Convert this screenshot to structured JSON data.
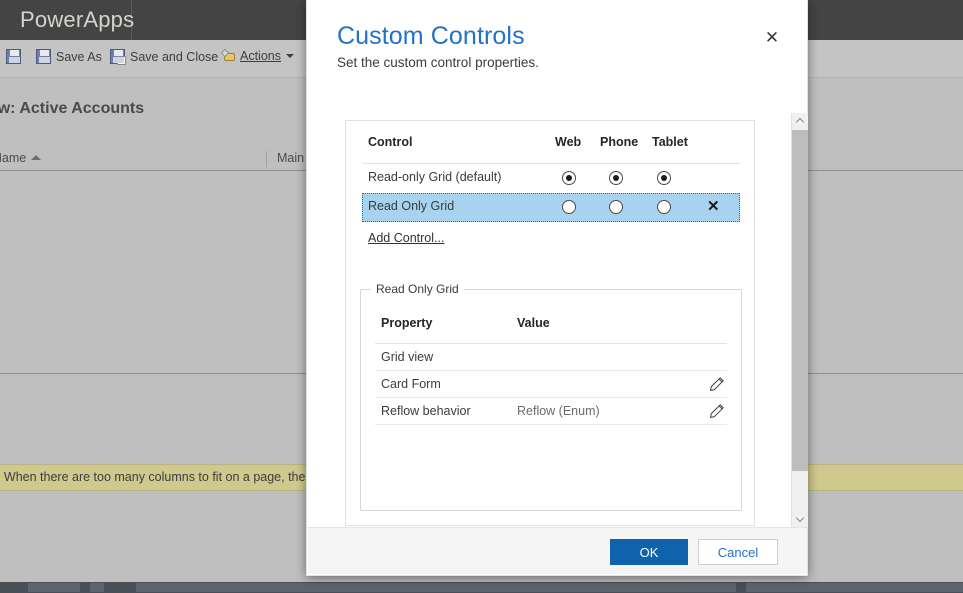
{
  "background": {
    "brand": "PowerApps",
    "toolbar": {
      "save_label": "",
      "save_as_label": "Save As",
      "save_and_close_label": "Save and Close",
      "actions_label": "Actions",
      "actions_caret": "▾"
    },
    "view_title": "View: Active Accounts",
    "grid_columns": [
      {
        "label": "unt Name",
        "sorted": "ascending"
      },
      {
        "label": "Main"
      }
    ],
    "notice": "e: When there are too many columns to fit on a page, the view"
  },
  "dialog": {
    "title": "Custom Controls",
    "subtitle": "Set the custom control properties.",
    "close_label": "✕",
    "controls_table": {
      "headers": [
        "Control",
        "Web",
        "Phone",
        "Tablet"
      ],
      "rows": [
        {
          "name": "Read-only Grid (default)",
          "web": true,
          "phone": true,
          "tablet": true,
          "selected": false,
          "removable": false,
          "remove_label": ""
        },
        {
          "name": "Read Only Grid",
          "web": false,
          "phone": false,
          "tablet": false,
          "selected": true,
          "removable": true,
          "remove_label": "✕"
        }
      ],
      "add_control_label": "Add Control..."
    },
    "properties": {
      "legend": "Read Only Grid",
      "headers": [
        "Property",
        "Value"
      ],
      "rows": [
        {
          "property": "Grid view",
          "value": "",
          "editable": false
        },
        {
          "property": "Card Form",
          "value": "",
          "editable": true
        },
        {
          "property": "Reflow behavior",
          "value": "Reflow (Enum)",
          "editable": true
        }
      ]
    },
    "footer": {
      "ok_label": "OK",
      "cancel_label": "Cancel"
    }
  },
  "colors": {
    "title_blue": "#2272c7",
    "primary_button": "#0f62ac",
    "selected_row": "#a8d3ef",
    "notice_bar": "#cfc98e",
    "topbar": "#444444"
  }
}
